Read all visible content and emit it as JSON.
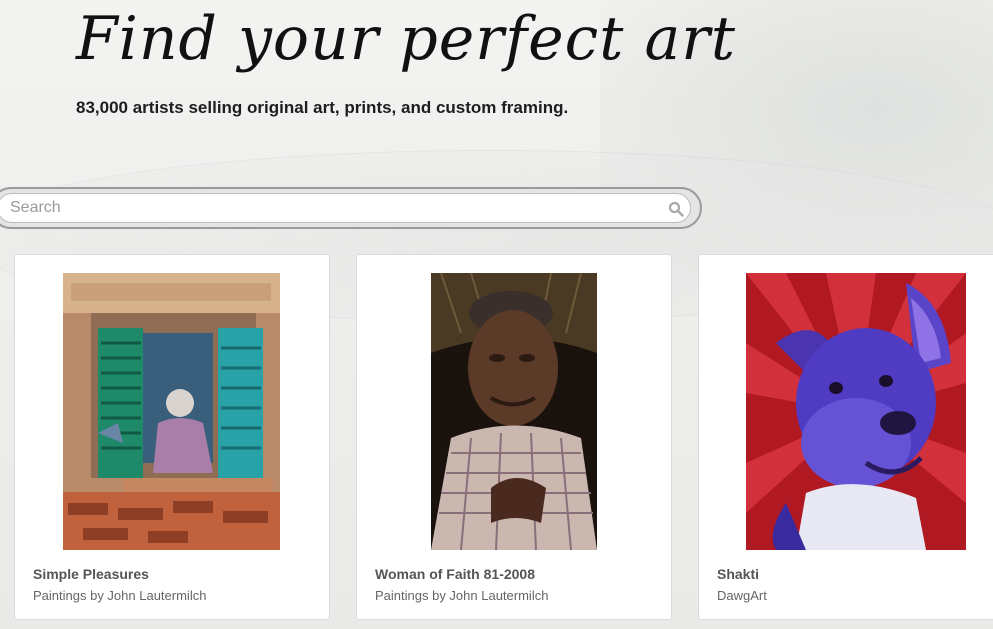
{
  "hero": {
    "title": "Find your perfect art",
    "subtitle": "83,000 artists selling original art, prints, and custom framing."
  },
  "search": {
    "placeholder": "Search",
    "value": ""
  },
  "cards": [
    {
      "title": "Simple Pleasures",
      "artist": "Paintings by John Lautermilch"
    },
    {
      "title": "Woman of Faith 81-2008",
      "artist": "Paintings by John Lautermilch"
    },
    {
      "title": "Shakti",
      "artist": "DawgArt"
    }
  ],
  "colors": {
    "background": "#eeeeec",
    "title_text": "#111111",
    "card_title": "#555555",
    "card_artist": "#666666"
  },
  "icons": {
    "search": "search-icon"
  }
}
